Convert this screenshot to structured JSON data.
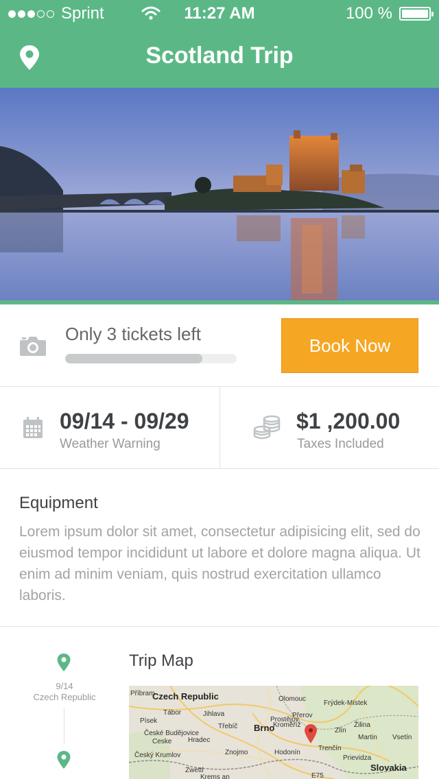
{
  "status_bar": {
    "carrier": "Sprint",
    "time": "11:27 AM",
    "battery": "100 %",
    "signal_bars_filled": 3,
    "signal_bars_total": 5
  },
  "nav": {
    "title": "Scotland Trip",
    "left_icon": "map-pin-icon"
  },
  "tickets": {
    "text": "Only 3 tickets left",
    "progress_percent": 80,
    "book_label": "Book Now"
  },
  "dates": {
    "range": "09/14 - 09/29",
    "note": "Weather Warning"
  },
  "price": {
    "amount": "$1 ,200.00",
    "note": "Taxes Included"
  },
  "equipment": {
    "title": "Equipment",
    "body": "Lorem ipsum dolor sit amet, consectetur adipisicing elit, sed do eiusmod tempor incididunt ut labore et dolore magna aliqua. Ut enim ad minim veniam, quis nostrud exercitation ullamco laboris."
  },
  "timeline": {
    "date": "9/14",
    "place": "Czech Republic"
  },
  "trip_map": {
    "title": "Trip Map",
    "labels": [
      "Příbram",
      "Czech Republic",
      "Olomouc",
      "Frýdek-Místek",
      "Písek",
      "Tábor",
      "Jihlava",
      "Přerov",
      "Prostějov",
      "Třebíč",
      "Brno",
      "Kroměříž",
      "Zlín",
      "Žilina",
      "České Budějovice",
      "Ceske",
      "Hradec",
      "Martin",
      "Český Krumlov",
      "Znojmo",
      "Hodonín",
      "Trenčín",
      "Prievidza",
      "Slovakia",
      "Zwettl",
      "Krems an",
      "Vsetín",
      "E75"
    ]
  },
  "colors": {
    "accent": "#5bb886",
    "button": "#f5a623"
  }
}
